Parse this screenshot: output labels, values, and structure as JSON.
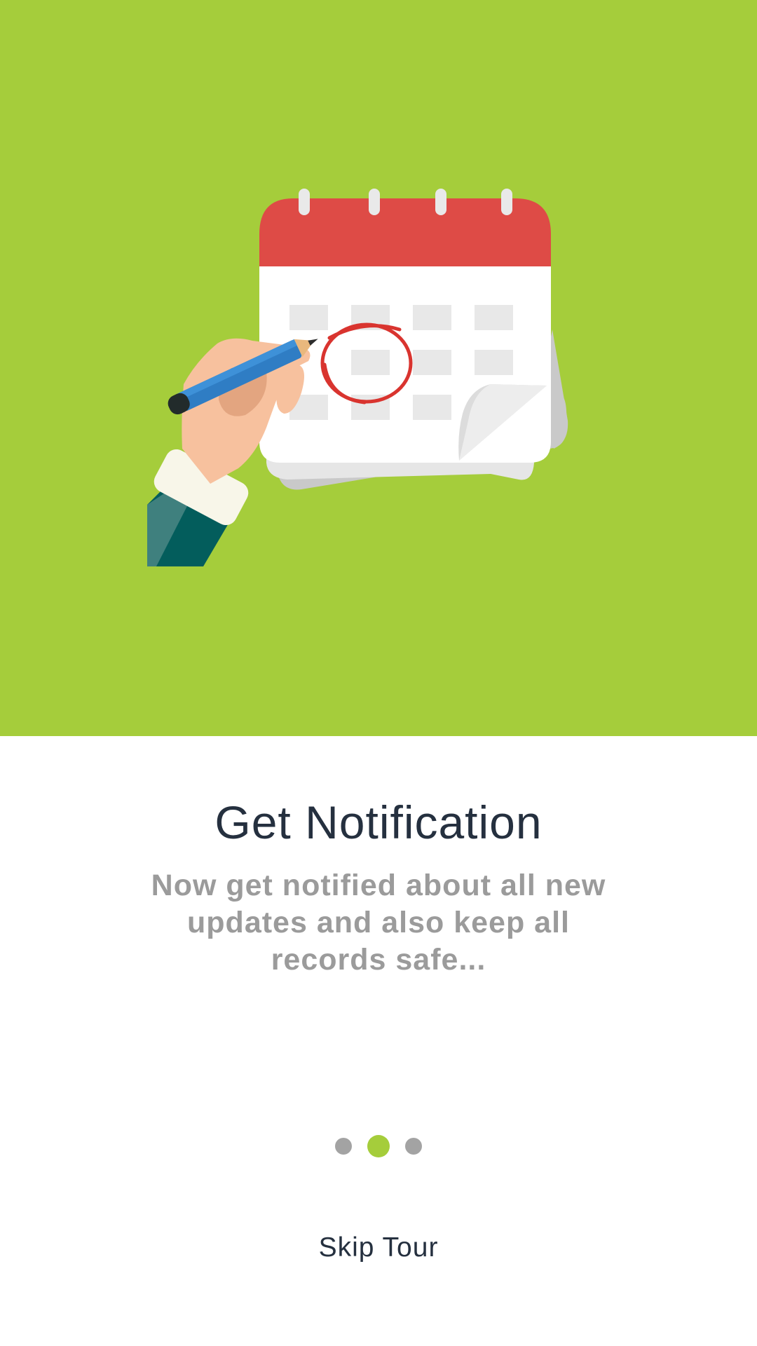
{
  "hero": {
    "background_color": "#a5cd3b",
    "illustration": "calendar-with-hand-circling-date"
  },
  "onboarding": {
    "title": "Get Notification",
    "description": "Now get notified about all new updates and also keep all records safe...",
    "current_page": 2,
    "total_pages": 3,
    "skip_label": "Skip Tour"
  },
  "colors": {
    "accent": "#a5cd3b",
    "title": "#25303f",
    "description": "#9b9b9b",
    "dot_inactive": "#a3a3a3",
    "calendar_header": "#de4b46",
    "circle_mark": "#d9342f",
    "pencil": "#2f7dc4"
  }
}
